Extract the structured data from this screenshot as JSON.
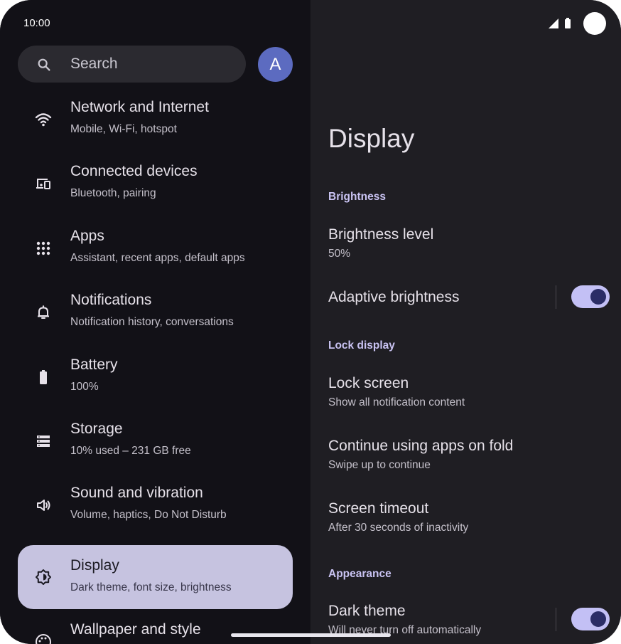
{
  "status_bar": {
    "time": "10:00"
  },
  "search": {
    "placeholder": "Search"
  },
  "account": {
    "initial": "A"
  },
  "sidebar": {
    "items": [
      {
        "title": "Network and Internet",
        "subtitle": "Mobile, Wi‑Fi, hotspot",
        "icon": "wifi-icon"
      },
      {
        "title": "Connected devices",
        "subtitle": "Bluetooth, pairing",
        "icon": "devices-icon"
      },
      {
        "title": "Apps",
        "subtitle": "Assistant, recent apps, default apps",
        "icon": "apps-grid-icon"
      },
      {
        "title": "Notifications",
        "subtitle": "Notification history, conversations",
        "icon": "bell-icon"
      },
      {
        "title": "Battery",
        "subtitle": "100%",
        "icon": "battery-icon"
      },
      {
        "title": "Storage",
        "subtitle": "10% used – 231 GB free",
        "icon": "storage-icon"
      },
      {
        "title": "Sound and vibration",
        "subtitle": "Volume, haptics, Do Not Disturb",
        "icon": "volume-icon"
      },
      {
        "title": "Display",
        "subtitle": "Dark theme, font size, brightness",
        "icon": "display-brightness-icon",
        "selected": true
      },
      {
        "title": "Wallpaper and style",
        "subtitle": "",
        "icon": "palette-icon"
      }
    ]
  },
  "detail": {
    "title": "Display",
    "sections": {
      "brightness": "Brightness",
      "lock_display": "Lock display",
      "appearance": "Appearance"
    },
    "prefs": {
      "brightness_level": {
        "title": "Brightness level",
        "summary": "50%"
      },
      "adaptive_brightness": {
        "title": "Adaptive brightness",
        "enabled": true
      },
      "lock_screen": {
        "title": "Lock screen",
        "summary": "Show all notification content"
      },
      "fold": {
        "title": "Continue using apps on fold",
        "summary": "Swipe up to continue"
      },
      "screen_timeout": {
        "title": "Screen timeout",
        "summary": "After 30 seconds of inactivity"
      },
      "dark_theme": {
        "title": "Dark theme",
        "summary": "Will never turn off automatically",
        "enabled": true
      }
    }
  },
  "colors": {
    "accent": "#c3c0f5",
    "selected_item_bg": "#c6c3e0",
    "avatar_bg": "#5c6bc0"
  }
}
